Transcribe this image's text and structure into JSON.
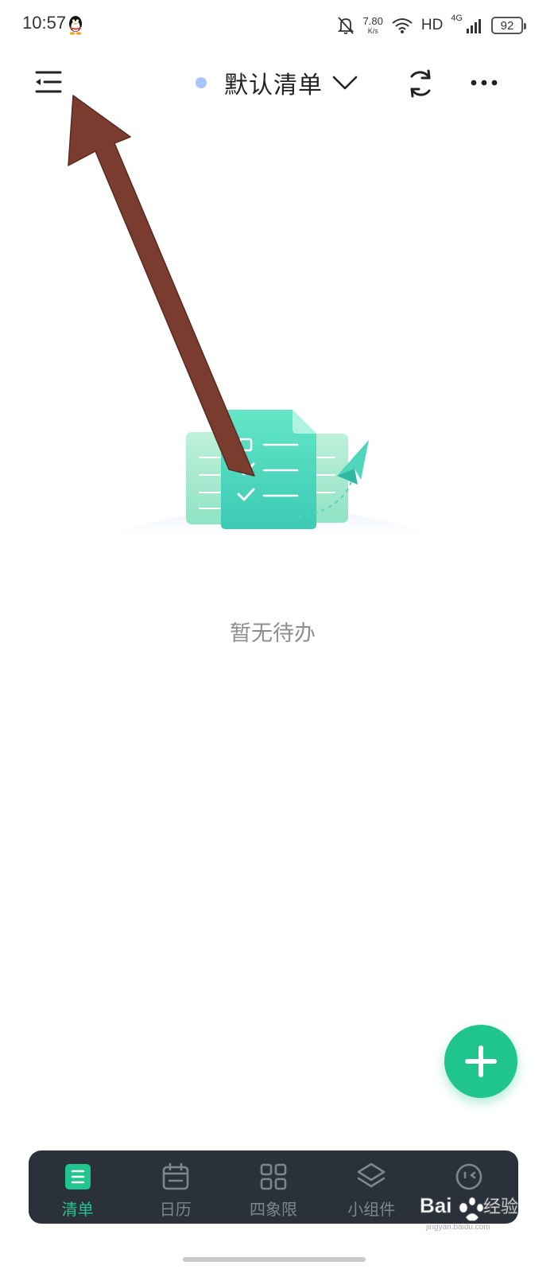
{
  "status_bar": {
    "time": "10:57",
    "net_speed_value": "7.80",
    "net_speed_unit": "K/s",
    "hd_label": "HD",
    "net_type": "4G",
    "battery_level": "92"
  },
  "toolbar": {
    "list_title": "默认清单",
    "list_dot_color": "#a8c6f5"
  },
  "empty_state": {
    "text": "暂无待办"
  },
  "fab": {
    "color": "#1fc58d",
    "icon": "plus-icon"
  },
  "bottom_nav": {
    "items": [
      {
        "label": "清单",
        "icon": "list-icon",
        "active": true
      },
      {
        "label": "日历",
        "icon": "calendar-icon",
        "active": false
      },
      {
        "label": "四象限",
        "icon": "quadrant-icon",
        "active": false
      },
      {
        "label": "小组件",
        "icon": "layers-icon",
        "active": false
      },
      {
        "label": "",
        "icon": "face-icon",
        "active": false
      }
    ],
    "accent": "#1fc58d"
  },
  "watermark": {
    "brand": "Bai",
    "brand_tail": "经验",
    "sub": "jingyan.baidu.com"
  }
}
